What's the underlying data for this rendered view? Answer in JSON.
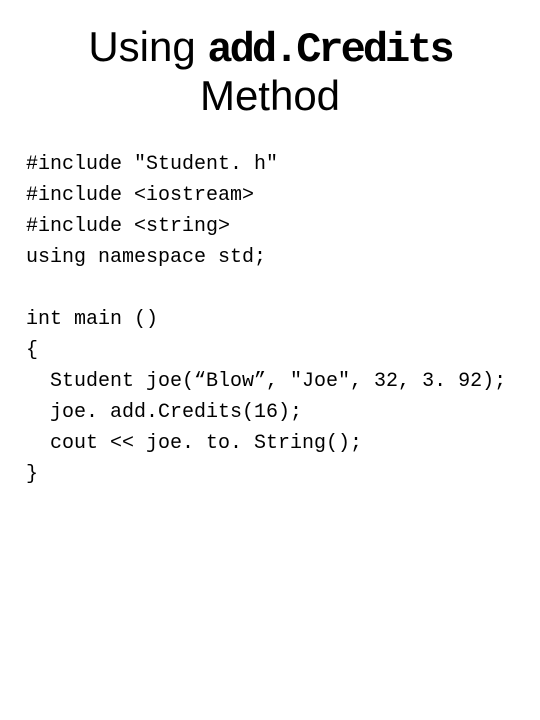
{
  "title": {
    "pre": "Using ",
    "mono": "add.Credits",
    "post": " Method"
  },
  "code": {
    "l1": "#include \"Student. h\"",
    "l2": "#include <iostream>",
    "l3": "#include <string>",
    "l4": "using namespace std;",
    "l5": "",
    "l6": "int main ()",
    "l7": "{",
    "l8": "  Student joe(“Blow”, \"Joe\", 32, 3. 92);",
    "l9": "  joe. add.Credits(16);",
    "l10": "  cout << joe. to. String();",
    "l11": "}"
  }
}
